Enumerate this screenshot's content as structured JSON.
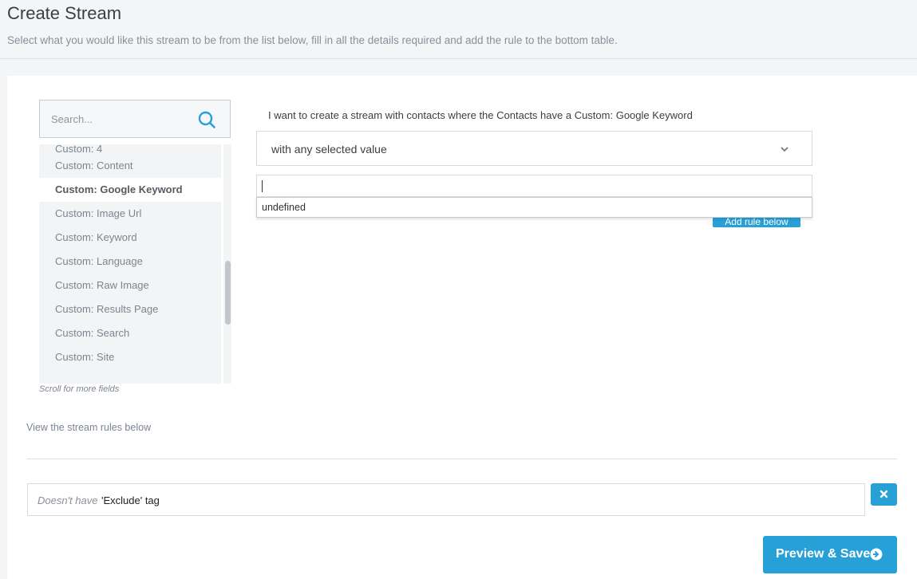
{
  "header": {
    "title": "Create Stream",
    "subtitle": "Select what you would like this stream to be from the list below, fill in all the details required and add the rule to the bottom table."
  },
  "search": {
    "placeholder": "Search...",
    "icon": "search-icon"
  },
  "fields": {
    "items": [
      {
        "label": "Custom: 4"
      },
      {
        "label": "Custom: Content"
      },
      {
        "label": "Custom: Google Keyword"
      },
      {
        "label": "Custom: Image Url"
      },
      {
        "label": "Custom: Keyword"
      },
      {
        "label": "Custom: Language"
      },
      {
        "label": "Custom: Raw Image"
      },
      {
        "label": "Custom: Results Page"
      },
      {
        "label": "Custom: Search"
      },
      {
        "label": "Custom: Site"
      }
    ],
    "selected": "Custom: Google Keyword",
    "scroll_hint": "Scroll for more fields"
  },
  "rule_builder": {
    "sentence": "I want to create a stream with contacts where the Contacts have a Custom: Google Keyword",
    "condition_value": "with any selected value",
    "value_input": "",
    "suggestions": [
      "undefined"
    ],
    "add_rule_label": "Add rule below"
  },
  "rules": {
    "caption": "View the stream rules below",
    "items": [
      {
        "qualifier": "Doesn't have",
        "text": "'Exclude' tag"
      }
    ]
  },
  "actions": {
    "preview_save_label": "Preview & Save"
  },
  "colors": {
    "accent": "#27a0d7",
    "background": "#f4f5f7",
    "panel": "#ffffff"
  }
}
